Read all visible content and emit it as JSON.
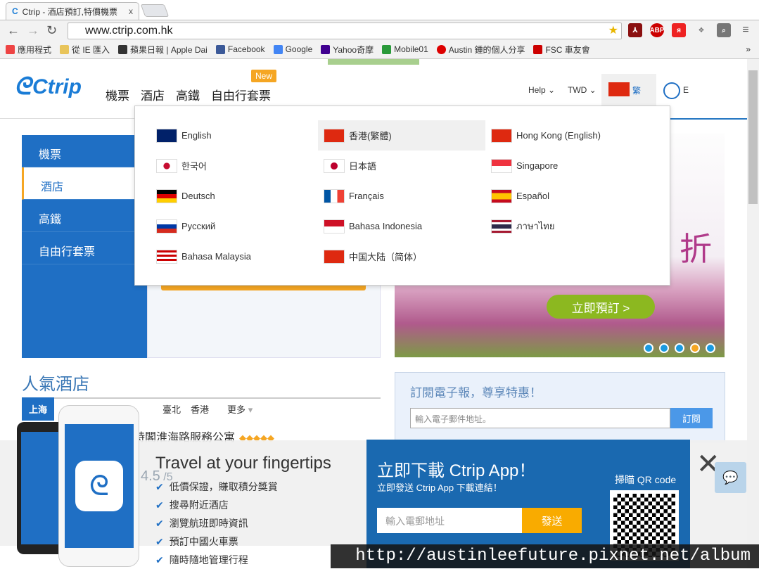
{
  "browser": {
    "tab_title": "Ctrip - 酒店預訂,特價機票",
    "tab_close": "x",
    "url": "www.ctrip.com.hk",
    "extensions": [
      "pdf-icon",
      "ABP",
      "vivaldi-icon",
      "dropbox-icon",
      "search-icon",
      "menu-icon"
    ],
    "bookmarks": [
      {
        "label": "應用程式",
        "color": "#e44"
      },
      {
        "label": "從 IE 匯入",
        "color": "#e8c45a"
      },
      {
        "label": "蘋果日報 | Apple Dai",
        "color": "#333"
      },
      {
        "label": "Facebook",
        "color": "#3b5998"
      },
      {
        "label": "Google",
        "color": "#4285f4"
      },
      {
        "label": "Yahoo奇摩",
        "color": "#400090"
      },
      {
        "label": "Mobile01",
        "color": "#2a9a3a"
      },
      {
        "label": "Austin 鍾的個人分享",
        "color": "#d00"
      },
      {
        "label": "FSC 車友會",
        "color": "#c00"
      }
    ],
    "bookmarks_more": "»"
  },
  "header": {
    "logo": "Ctrip",
    "nav": [
      "機票",
      "酒店",
      "高鐵",
      "自由行套票"
    ],
    "new_badge": "New",
    "help": "Help",
    "currency": "TWD",
    "lang": "繁",
    "user": "E"
  },
  "language_menu": [
    {
      "label": "English",
      "flag": "uk"
    },
    {
      "label": "香港(繁體)",
      "flag": "hk",
      "selected": true
    },
    {
      "label": "Hong Kong (English)",
      "flag": "hk"
    },
    {
      "label": "한국어",
      "flag": "kr"
    },
    {
      "label": "日本語",
      "flag": "jp"
    },
    {
      "label": "Singapore",
      "flag": "sg"
    },
    {
      "label": "Deutsch",
      "flag": "de"
    },
    {
      "label": "Français",
      "flag": "fr"
    },
    {
      "label": "Español",
      "flag": "es"
    },
    {
      "label": "Русский",
      "flag": "ru"
    },
    {
      "label": "Bahasa Indonesia",
      "flag": "id"
    },
    {
      "label": "ภาษาไทย",
      "flag": "th"
    },
    {
      "label": "Bahasa Malaysia",
      "flag": "my"
    },
    {
      "label": "中国大陆（简体）",
      "flag": "cn"
    }
  ],
  "side_menu": [
    "機票",
    "酒店",
    "高鐵",
    "自由行套票"
  ],
  "banner": {
    "promo_char": "折",
    "book_now": "立即預訂 >",
    "slides": 5,
    "active_slide": 4
  },
  "popular": {
    "title": "人氣酒店",
    "cities": [
      "上海",
      "臺北",
      "香港"
    ],
    "more": "更多",
    "hotel": "時閣淮海路服務公寓",
    "rating": "4.5"
  },
  "newsletter": {
    "title": "訂閱電子報，尊享特惠！",
    "placeholder": "輸入電子郵件地址。",
    "button": "訂閱"
  },
  "app_promo": {
    "headline": "Travel at your fingertips",
    "features": [
      "低價保證，賺取積分獎賞",
      "搜尋附近酒店",
      "瀏覽航班即時資訊",
      "預訂中國火車票",
      "隨時隨地管理行程"
    ],
    "title": "立即下載 Ctrip App！",
    "subtitle": "立即發送 Ctrip App 下載連結！",
    "email_placeholder": "輸入電郵地址",
    "send": "發送",
    "qr_label": "掃瞄 QR code",
    "close": "✕"
  },
  "watermark": "http://austinleefuture.pixnet.net/album"
}
